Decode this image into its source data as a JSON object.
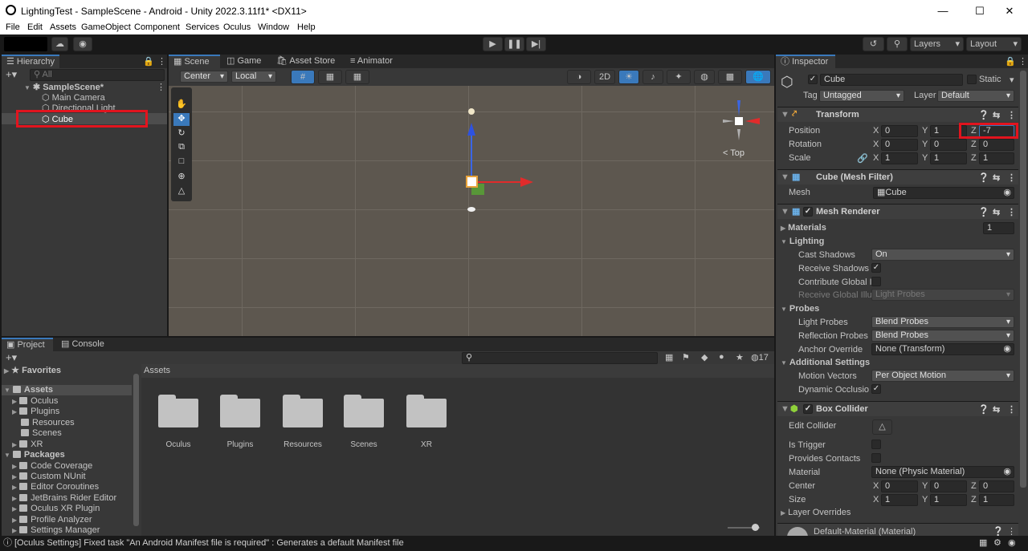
{
  "window": {
    "title": "LightingTest - SampleScene - Android - Unity 2022.3.11f1* <DX11>"
  },
  "menu": [
    "File",
    "Edit",
    "Assets",
    "GameObject",
    "Component",
    "Services",
    "Oculus",
    "Window",
    "Help"
  ],
  "toolbar": {
    "layers": "Layers",
    "layout": "Layout"
  },
  "hierarchy": {
    "tab": "Hierarchy",
    "search_placeholder": "All",
    "scene": "SampleScene*",
    "items": [
      "Main Camera",
      "Directional Light",
      "Cube"
    ]
  },
  "scene_tabs": [
    "Scene",
    "Game",
    "Asset Store",
    "Animator"
  ],
  "scene_toolbar": {
    "pivot": "Center",
    "space": "Local",
    "mode2d": "2D"
  },
  "gizmo": {
    "view_label": "Top"
  },
  "project": {
    "tabs": [
      "Project",
      "Console"
    ],
    "favorites": "Favorites",
    "assets_root": "Assets",
    "asset_folders": [
      "Oculus",
      "Plugins",
      "Resources",
      "Scenes",
      "XR"
    ],
    "packages_root": "Packages",
    "packages": [
      "Code Coverage",
      "Custom NUnit",
      "Editor Coroutines",
      "JetBrains Rider Editor",
      "Oculus XR Plugin",
      "Profile Analyzer",
      "Settings Manager"
    ],
    "breadcrumb": "Assets",
    "hidden_count": "17"
  },
  "inspector": {
    "tab": "Inspector",
    "object_name": "Cube",
    "static_label": "Static",
    "tag_label": "Tag",
    "tag_value": "Untagged",
    "layer_label": "Layer",
    "layer_value": "Default",
    "transform": {
      "title": "Transform",
      "position": {
        "label": "Position",
        "x": "0",
        "y": "1",
        "z": "-7"
      },
      "rotation": {
        "label": "Rotation",
        "x": "0",
        "y": "0",
        "z": "0"
      },
      "scale": {
        "label": "Scale",
        "x": "1",
        "y": "1",
        "z": "1"
      }
    },
    "mesh_filter": {
      "title": "Cube (Mesh Filter)",
      "mesh_label": "Mesh",
      "mesh_value": "Cube"
    },
    "mesh_renderer": {
      "title": "Mesh Renderer",
      "materials_label": "Materials",
      "materials_count": "1",
      "lighting_label": "Lighting",
      "cast_shadows_label": "Cast Shadows",
      "cast_shadows_value": "On",
      "receive_shadows_label": "Receive Shadows",
      "contribute_gi_label": "Contribute Global Il",
      "receive_gi_label": "Receive Global Illu",
      "receive_gi_value": "Light Probes",
      "probes_label": "Probes",
      "light_probes_label": "Light Probes",
      "light_probes_value": "Blend Probes",
      "reflection_probes_label": "Reflection Probes",
      "reflection_probes_value": "Blend Probes",
      "anchor_override_label": "Anchor Override",
      "anchor_override_value": "None (Transform)",
      "additional_label": "Additional Settings",
      "motion_vectors_label": "Motion Vectors",
      "motion_vectors_value": "Per Object Motion",
      "dynamic_occlusion_label": "Dynamic Occlusion"
    },
    "box_collider": {
      "title": "Box Collider",
      "edit_collider": "Edit Collider",
      "is_trigger": "Is Trigger",
      "provides_contacts": "Provides Contacts",
      "material_label": "Material",
      "material_value": "None (Physic Material)",
      "center": {
        "label": "Center",
        "x": "0",
        "y": "0",
        "z": "0"
      },
      "size": {
        "label": "Size",
        "x": "1",
        "y": "1",
        "z": "1"
      },
      "layer_overrides": "Layer Overrides"
    },
    "material": "Default-Material (Material)"
  },
  "axis_letters": {
    "x": "X",
    "y": "Y",
    "z": "Z"
  },
  "status": "[Oculus Settings] Fixed task \"An Android Manifest file is required\" : Generates a default Manifest file"
}
